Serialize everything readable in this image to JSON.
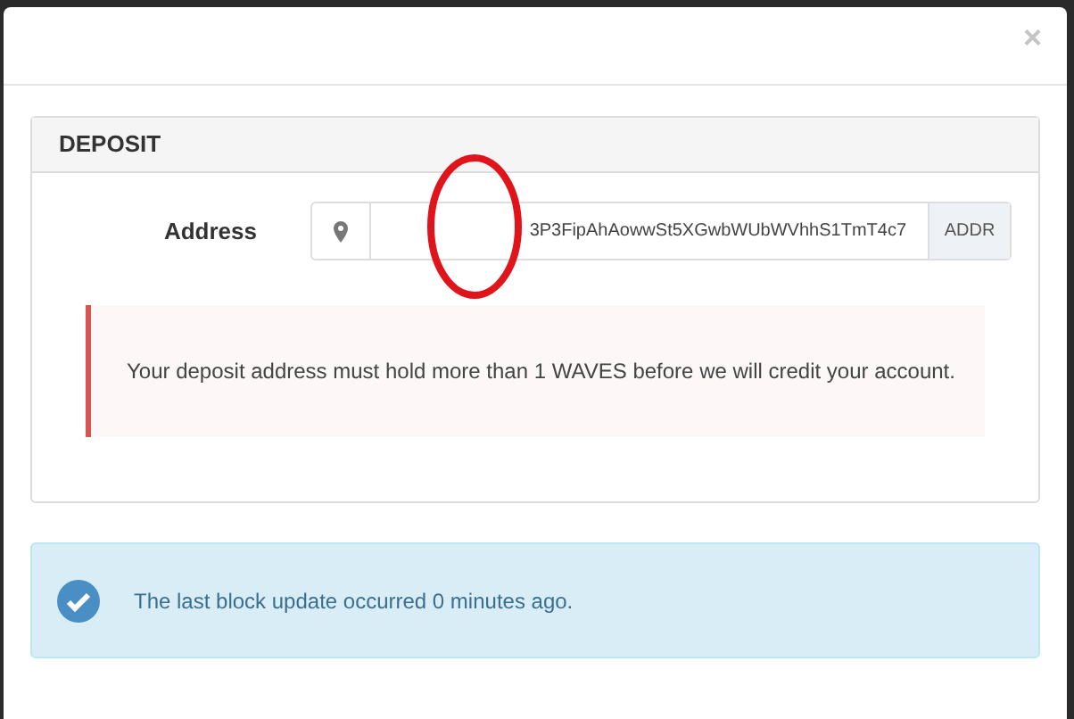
{
  "modal": {
    "close": "×"
  },
  "panel": {
    "title": "DEPOSIT",
    "address": {
      "label": "Address",
      "value": "3P3FipAhAowwSt5XGwbWUbWVhhS1TmT4c7",
      "addon": "ADDR"
    },
    "warning": "Your deposit address must hold more than 1 WAVES before we will credit your account."
  },
  "info": {
    "text": "The last block update occurred 0 minutes ago."
  }
}
